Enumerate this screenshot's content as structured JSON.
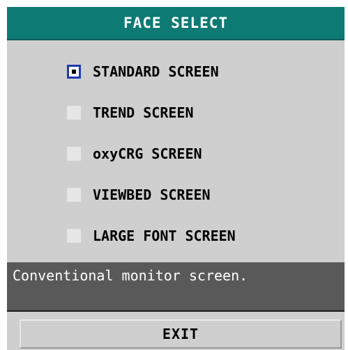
{
  "dialog": {
    "title": "FACE SELECT",
    "accent_color": "#0d7a73",
    "options": [
      {
        "label": "STANDARD SCREEN",
        "checked": true
      },
      {
        "label": "TREND SCREEN",
        "checked": false
      },
      {
        "label": "oxyCRG SCREEN",
        "checked": false
      },
      {
        "label": "VIEWBED SCREEN",
        "checked": false
      },
      {
        "label": "LARGE FONT SCREEN",
        "checked": false
      }
    ],
    "description": "Conventional monitor screen.",
    "exit_label": "EXIT"
  }
}
